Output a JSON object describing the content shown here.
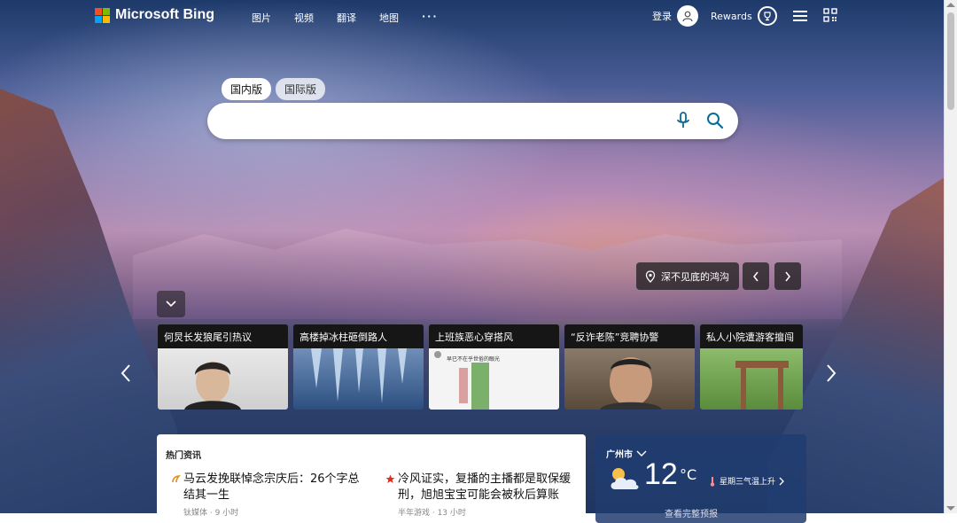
{
  "header": {
    "logo_text": "Microsoft Bing",
    "nav": [
      "图片",
      "视频",
      "翻译",
      "地图"
    ],
    "more_label": "···",
    "signin_label": "登录",
    "rewards_label": "Rewards"
  },
  "search": {
    "tabs": [
      "国内版",
      "国际版"
    ],
    "active_tab": "国内版",
    "placeholder": "",
    "value": ""
  },
  "background": {
    "location_label": "深不见底的鸿沟"
  },
  "cards": [
    {
      "title": "何炅长发狼尾引热议"
    },
    {
      "title": "高楼掉冰柱砸倒路人"
    },
    {
      "title": "上班族恶心穿搭风"
    },
    {
      "title": "“反诈老陈”竞聘协警"
    },
    {
      "title": "私人小院遭游客擅闯"
    }
  ],
  "card_overlay_text": "早已不在乎世俗的眼光",
  "news": {
    "header": "热门资讯",
    "items": [
      {
        "title": "马云发挽联悼念宗庆后：26个字总结其一生",
        "source": "钛媒体 · 9 小时"
      },
      {
        "title": "冷风证实，复播的主播都是取保缓刑，旭旭宝宝可能会被秋后算账",
        "source": "半年游戏 · 13 小时"
      }
    ]
  },
  "weather": {
    "city": "广州市",
    "temp": "12",
    "unit": "°C",
    "trend": "星期三气温上升",
    "more": "查看完整预报"
  },
  "colors": {
    "ms_red": "#f25022",
    "ms_green": "#7fba00",
    "ms_blue": "#00a4ef",
    "ms_yellow": "#ffb900",
    "search_accent": "#0c6b94"
  }
}
